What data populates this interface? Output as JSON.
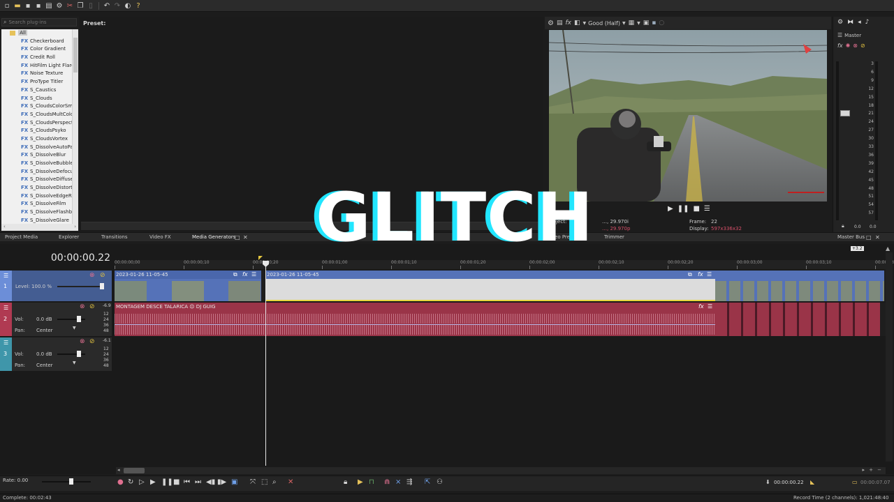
{
  "plugins": {
    "search_placeholder": "Search plug-ins",
    "root_label": "All",
    "items": [
      "Checkerboard",
      "Color Gradient",
      "Credit Roll",
      "HitFilm Light Flares",
      "Noise Texture",
      "ProType Titler",
      "S_Caustics",
      "S_Clouds",
      "S_CloudsColorSmooth",
      "S_CloudsMultColor",
      "S_CloudsPerspective",
      "S_CloudsPsyko",
      "S_CloudsVortex",
      "S_DissolveAutoPaint",
      "S_DissolveBlur",
      "S_DissolveBubble",
      "S_DissolveDefocus",
      "S_DissolveDiffuse",
      "S_DissolveDistort",
      "S_DissolveEdgeRays",
      "S_DissolveFilm",
      "S_DissolveFlashbulb",
      "S_DissolveGlare"
    ],
    "fx_tag": "FX"
  },
  "preset": {
    "label": "Preset:"
  },
  "preview": {
    "quality": "Good (Half)",
    "project_label": "Project:",
    "project_value": "…, 29.970i",
    "preview_value": "…, 29.970p",
    "frame_label": "Frame:",
    "frame_value": "22",
    "display_label": "Display:",
    "display_value": "597x336x32"
  },
  "master": {
    "label": "Master",
    "scale": [
      "3",
      "6",
      "9",
      "12",
      "15",
      "18",
      "21",
      "24",
      "27",
      "30",
      "33",
      "36",
      "39",
      "42",
      "45",
      "48",
      "51",
      "54",
      "57"
    ],
    "bottom_left": "0.0",
    "bottom_right": "0.0"
  },
  "tabs": {
    "project_media": "Project Media",
    "explorer": "Explorer",
    "transitions": "Transitions",
    "video_fx": "Video FX",
    "media_generators": "Media Generators",
    "video_preview": "Video Preview",
    "trimmer": "Trimmer",
    "master_bus": "Master Bus"
  },
  "timeline": {
    "time": "00:00:00.22",
    "ruler_labels": [
      "00:00:00;00",
      "00:00:00;10",
      "00:00:00;20",
      "00:00:01;00",
      "00:00:01;10",
      "00:00:01;20",
      "00:00:02;00",
      "00:00:02;10",
      "00:00:02;20",
      "00:00:03;00",
      "00:00:03;10",
      "00:00:03;20"
    ],
    "track1": {
      "number": "1",
      "level_label": "Level: 100.0 %"
    },
    "track2": {
      "number": "2",
      "vol_label": "Vol:",
      "vol_value": "0.0 dB",
      "pan_label": "Pan:",
      "pan_value": "Center",
      "peak": "-6.9"
    },
    "track3": {
      "number": "3",
      "vol_label": "Vol:",
      "vol_value": "0.0 dB",
      "pan_label": "Pan:",
      "pan_value": "Center",
      "peak": "-6.1"
    },
    "db_scale": [
      "12",
      "24",
      "36",
      "48"
    ],
    "video_clip1": "2023-01-26 11-05-45",
    "video_clip2": "2023-01-26 11-05-45",
    "audio_clip": "MONTAGEM  DESCE TALARICA  ☹  DJ GUIG",
    "zoom_badge": "+3.2"
  },
  "transport": {
    "rate_label": "Rate: 0.00",
    "cursor_time": "00:00:00.22",
    "selection_length": "00:00:07.07"
  },
  "status": {
    "complete": "Complete: 00:02:43",
    "record_time": "Record Time (2 channels): 1,021:48:40"
  },
  "overlay": {
    "text": "GLITCH"
  },
  "colors": {
    "video_track": "#5572b8",
    "audio_track": "#9a3448",
    "audio2_track": "#3f96aa",
    "accent_cyan": "#22e6ff"
  }
}
